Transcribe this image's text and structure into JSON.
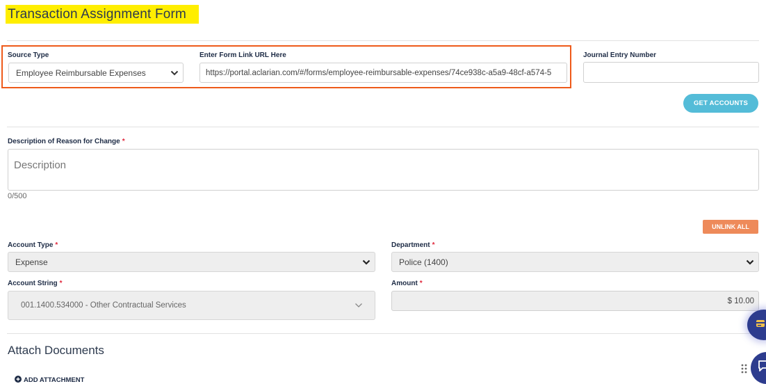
{
  "page": {
    "title": "Transaction Assignment Form"
  },
  "source": {
    "label": "Source Type",
    "value": "Employee Reimbursable Expenses"
  },
  "form_link": {
    "label": "Enter Form Link URL Here",
    "value": "https://portal.aclarian.com/#/forms/employee-reimbursable-expenses/74ce938c-a5a9-48cf-a574-5"
  },
  "journal": {
    "label": "Journal Entry Number",
    "value": ""
  },
  "buttons": {
    "get_accounts": "GET ACCOUNTS",
    "unlink_all": "UNLINK ALL"
  },
  "description": {
    "label": "Description of Reason for Change",
    "placeholder": "Description",
    "counter": "0/500"
  },
  "account_type": {
    "label": "Account Type",
    "value": "Expense"
  },
  "department": {
    "label": "Department",
    "value": "Police (1400)"
  },
  "account_string": {
    "label": "Account String",
    "value": "001.1400.534000 - Other Contractual Services"
  },
  "amount": {
    "label": "Amount",
    "value": "$ 10.00"
  },
  "required_mark": "*",
  "attachments": {
    "title": "Attach Documents",
    "add_label": "ADD ATTACHMENT"
  },
  "colors": {
    "title_highlight": "#ffee00",
    "focus_box": "#ee5a1a",
    "get_accounts_button": "#54bcd8",
    "unlink_button": "#ee8a5a",
    "fab": "#2d3c8e"
  },
  "icons": [
    "chevron-down-icon",
    "plus-circle-icon",
    "card-icon",
    "chat-icon",
    "drag-dots-icon"
  ]
}
